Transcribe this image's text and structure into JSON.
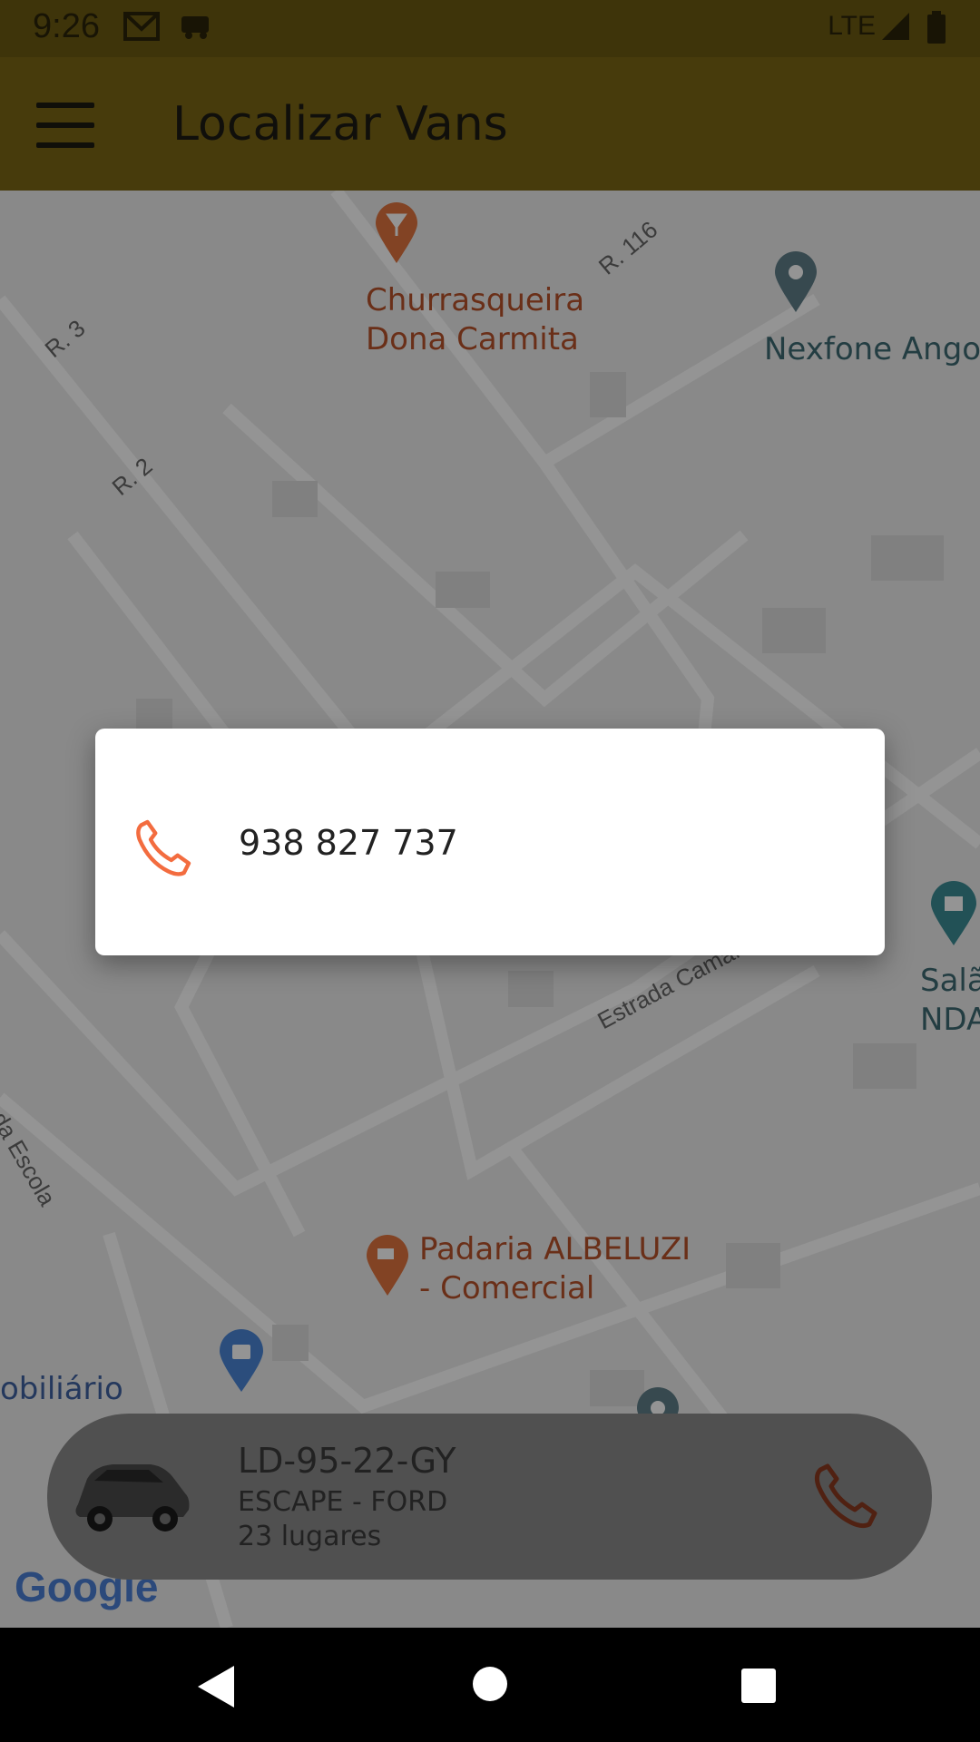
{
  "status_bar": {
    "time": "9:26",
    "network": "LTE"
  },
  "app_bar": {
    "title": "Localizar Vans"
  },
  "map": {
    "streets": [
      "R. 116",
      "R. 3",
      "R. 2",
      "Atalho da Escola",
      "Estrada Camama-Tala"
    ],
    "pois": {
      "churrasqueira": "Churrasqueira\nDona Carmita",
      "nexfone": "Nexfone Angol",
      "salao": "Salã\nNDA",
      "padaria": "Padaria ALBELUZI\n- Comercial",
      "mobiliario": "obiliário"
    },
    "attribution": "Google"
  },
  "dialog": {
    "phone_number": "938 827 737"
  },
  "vehicle": {
    "plate": "LD-95-22-GY",
    "model": "ESCAPE - FORD",
    "seats": "23 lugares"
  },
  "colors": {
    "accent": "#f36c3f",
    "app_bar": "#f7cf2d"
  }
}
